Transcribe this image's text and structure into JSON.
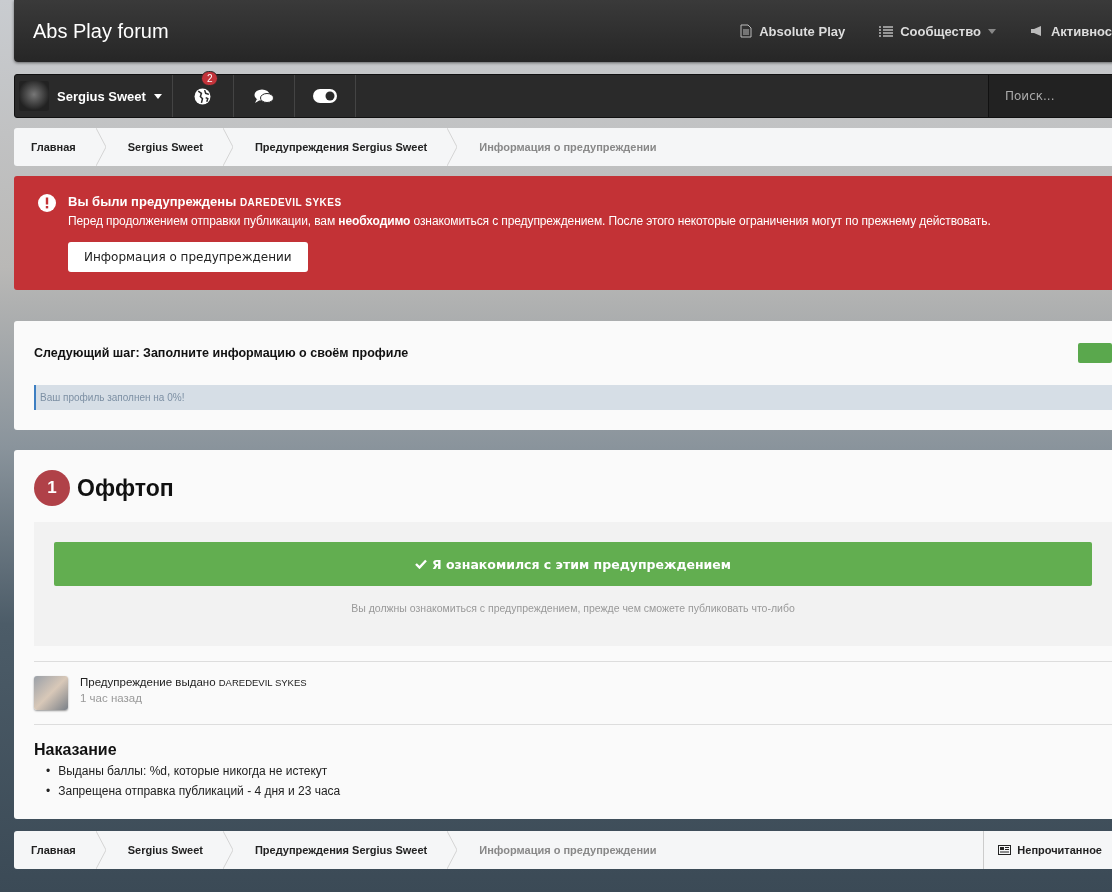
{
  "header": {
    "title": "Abs Play forum",
    "nav": [
      {
        "kind": "page",
        "label": "Absolute Play",
        "caret": false
      },
      {
        "kind": "list",
        "label": "Сообщество",
        "caret": true
      },
      {
        "kind": "megaphone",
        "label": "Активнос",
        "caret": false
      }
    ]
  },
  "userbar": {
    "username": "Sergius Sweet",
    "notifications": "2",
    "theme_toggle": {
      "on": true
    },
    "search": {
      "placeholder": "Поиск..."
    }
  },
  "breadcrumbs": [
    {
      "label": "Главная",
      "current": false
    },
    {
      "label": "Sergius Sweet",
      "current": false
    },
    {
      "label": "Предупреждения Sergius Sweet",
      "current": false
    },
    {
      "label": "Информация о предупреждении",
      "current": true
    }
  ],
  "alert": {
    "title": "Вы были предупреждены",
    "moderator": "DAREDEVIL SYKES",
    "text": "Перед продолжением отправки публикации, вам **необходимо** ознакомиться с предупреждением. После этого некоторые ограничения могут по прежнему действовать.",
    "button": "Информация о предупреждении"
  },
  "profile_step": {
    "title": "Следующий шаг: Заполните информацию о своём профиле",
    "progress_text": "Ваш профиль заполнен на 0%!",
    "level": 0
  },
  "warning": {
    "points": "1",
    "title": "Оффтоп",
    "acknowledge_button": "Я ознакомился с этим предупреждением",
    "note": "Вы должны ознакомиться с предупреждением, прежде чем сможете публиковать что-либо",
    "issued_by": "Предупреждение выдано",
    "moderator": "DAREDEVIL SYKES",
    "time": "1 час назад",
    "penalty_title": "Наказание",
    "bullet": "•",
    "penalties": [
      "Выданы баллы: %d, которые никогда не истекут",
      "Запрещена отправка публикаций - 4 дня и 23 часа"
    ]
  },
  "footer": {
    "breadcrumbs": [
      {
        "label": "Главная",
        "current": false
      },
      {
        "label": "Sergius Sweet",
        "current": false
      },
      {
        "label": "Предупреждения Sergius Sweet",
        "current": false
      },
      {
        "label": "Информация о предупреждении",
        "current": true
      }
    ],
    "unread": "Непрочитанное"
  }
}
